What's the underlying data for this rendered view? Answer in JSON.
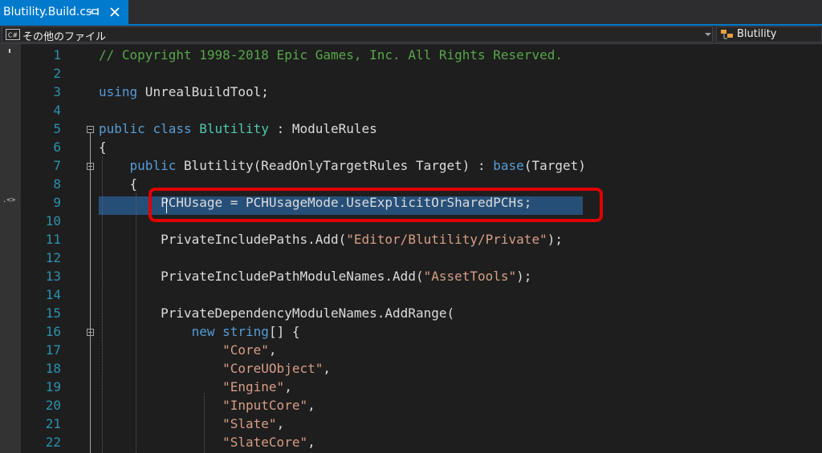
{
  "tab": {
    "title": "Blutility.Build.cs"
  },
  "navigation_bar": {
    "project": "その他のファイル",
    "type": "Blutility"
  },
  "editor": {
    "line_numbers": [
      "1",
      "2",
      "3",
      "4",
      "5",
      "6",
      "7",
      "8",
      "9",
      "10",
      "11",
      "12",
      "13",
      "14",
      "15",
      "16",
      "17",
      "18",
      "19",
      "20",
      "21",
      "22"
    ],
    "peek_marker": ".<>",
    "lines": [
      [
        {
          "t": "// Copyright 1998-2018 Epic Games, Inc. All Rights Reserved.",
          "c": "comment"
        }
      ],
      [],
      [
        {
          "t": "using",
          "c": "keyword"
        },
        {
          "t": " UnrealBuildTool;",
          "c": "plain"
        }
      ],
      [],
      [
        {
          "t": "public",
          "c": "keyword"
        },
        {
          "t": " ",
          "c": "plain"
        },
        {
          "t": "class",
          "c": "keyword"
        },
        {
          "t": " ",
          "c": "plain"
        },
        {
          "t": "Blutility",
          "c": "type"
        },
        {
          "t": " : ModuleRules",
          "c": "plain"
        }
      ],
      [
        {
          "t": "{",
          "c": "plain"
        }
      ],
      [
        {
          "t": "    ",
          "c": "plain"
        },
        {
          "t": "public",
          "c": "keyword"
        },
        {
          "t": " Blutility(ReadOnlyTargetRules Target) : ",
          "c": "plain"
        },
        {
          "t": "base",
          "c": "keyword"
        },
        {
          "t": "(Target)",
          "c": "plain"
        }
      ],
      [
        {
          "t": "    {",
          "c": "plain"
        }
      ],
      [
        {
          "t": "        PCHUsage = PCHUsageMode.UseExplicitOrSharedPCHs;",
          "c": "plain"
        }
      ],
      [],
      [
        {
          "t": "        PrivateIncludePaths.Add(",
          "c": "plain"
        },
        {
          "t": "\"Editor/Blutility/Private\"",
          "c": "string"
        },
        {
          "t": ");",
          "c": "plain"
        }
      ],
      [],
      [
        {
          "t": "        PrivateIncludePathModuleNames.Add(",
          "c": "plain"
        },
        {
          "t": "\"AssetTools\"",
          "c": "string"
        },
        {
          "t": ");",
          "c": "plain"
        }
      ],
      [],
      [
        {
          "t": "        PrivateDependencyModuleNames.AddRange(",
          "c": "plain"
        }
      ],
      [
        {
          "t": "            ",
          "c": "plain"
        },
        {
          "t": "new",
          "c": "keyword"
        },
        {
          "t": " ",
          "c": "plain"
        },
        {
          "t": "string",
          "c": "keyword"
        },
        {
          "t": "[] {",
          "c": "plain"
        }
      ],
      [
        {
          "t": "                ",
          "c": "plain"
        },
        {
          "t": "\"Core\"",
          "c": "string"
        },
        {
          "t": ",",
          "c": "plain"
        }
      ],
      [
        {
          "t": "                ",
          "c": "plain"
        },
        {
          "t": "\"CoreUObject\"",
          "c": "string"
        },
        {
          "t": ",",
          "c": "plain"
        }
      ],
      [
        {
          "t": "                ",
          "c": "plain"
        },
        {
          "t": "\"Engine\"",
          "c": "string"
        },
        {
          "t": ",",
          "c": "plain"
        }
      ],
      [
        {
          "t": "                ",
          "c": "plain"
        },
        {
          "t": "\"InputCore\"",
          "c": "string"
        },
        {
          "t": ",",
          "c": "plain"
        }
      ],
      [
        {
          "t": "                ",
          "c": "plain"
        },
        {
          "t": "\"Slate\"",
          "c": "string"
        },
        {
          "t": ",",
          "c": "plain"
        }
      ],
      [
        {
          "t": "                ",
          "c": "plain"
        },
        {
          "t": "\"SlateCore\"",
          "c": "string"
        },
        {
          "t": ",",
          "c": "plain"
        }
      ]
    ],
    "selected_line": 9,
    "highlighted_line": 9
  },
  "colors": {
    "background": "#1e1e1e",
    "tab_active": "#007acc",
    "line_number": "#2b91af",
    "comment": "#57a64a",
    "keyword": "#569cd6",
    "type": "#4ec9b0",
    "string": "#d69d85",
    "plain": "#dcdcdc",
    "selection": "#264f78",
    "highlight_box": "#e00000"
  },
  "icons": {
    "tab_pin": "pin-icon",
    "tab_close": "close-icon",
    "project": "csharp-file-icon",
    "project_dropdown": "chevron-down-icon",
    "type": "class-icon"
  }
}
